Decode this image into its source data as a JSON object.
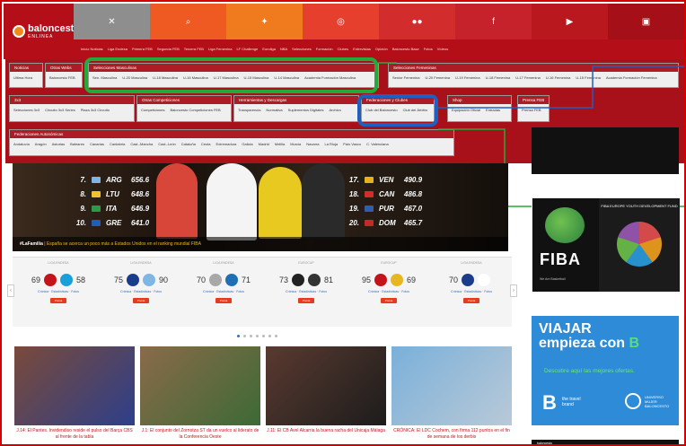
{
  "header": {
    "logo_text": "baloncesto",
    "logo_sub": "ENLINEA",
    "social_icons": [
      {
        "name": "x-icon",
        "glyph": "✕",
        "color": "#8e8e8e"
      },
      {
        "name": "search-icon",
        "glyph": "⌕",
        "color": "#ee5a22"
      },
      {
        "name": "twitter-icon",
        "glyph": "✦",
        "color": "#f07a1e"
      },
      {
        "name": "instagram-icon",
        "glyph": "◎",
        "color": "#e63f2d"
      },
      {
        "name": "flickr-icon",
        "glyph": "●●",
        "color": "#d22c2c"
      },
      {
        "name": "facebook-icon",
        "glyph": "f",
        "color": "#c6222b"
      },
      {
        "name": "youtube-icon",
        "glyph": "▶",
        "color": "#b9181f"
      },
      {
        "name": "app-icon",
        "glyph": "▣",
        "color": "#a51018"
      }
    ],
    "nav_links": [
      "Inicio Noticias",
      "Liga Endesa",
      "Primera FEB",
      "Segunda FEB",
      "Tercera FEB",
      "Liga Femenina",
      "LF Challenge",
      "Euroliga",
      "NBA",
      "Selecciones",
      "Formación",
      "Clubes",
      "Entrevistas",
      "Opinión",
      "Baloncesto Base",
      "Fotos",
      "Vídeos"
    ]
  },
  "menu": {
    "noticias": {
      "title": "Noticias",
      "items": [
        "Ultima Hora"
      ]
    },
    "otras": {
      "title": "Otras Webs",
      "items": [
        "Baloncesto FEB"
      ]
    },
    "masc": {
      "title": "Selecciones Masculinas",
      "items": [
        "Sen. Masculina",
        "U-20 Masculina",
        "U-18 Masculina",
        "U-16 Masculina",
        "U-17 Masculina",
        "U-15 Masculina",
        "U-14 Masculina",
        "Academia Formación Masculina"
      ]
    },
    "fem": {
      "title": "Selecciones Femeninas",
      "items": [
        "Senior Femenina",
        "U-20 Femenina",
        "U-19 Femenina",
        "U-18 Femenina",
        "U-17 Femenina",
        "U-16 Femenina",
        "U-15 Femenina",
        "Academia Formación Femenina"
      ]
    },
    "tres": {
      "title": "3x3",
      "items": [
        "Selecciones 3x3",
        "Circuito 3x3 Series",
        "Plaza 3x3 Circuito"
      ]
    },
    "comp": {
      "title": "Otras Competiciones",
      "items": [
        "Competiciones",
        "Baloncesto Competiciones FEB"
      ]
    },
    "herr": {
      "title": "Herramientas y Descargas",
      "items": [
        "Transparencia",
        "Normativa",
        "Suplementos Digitales",
        "Archivo"
      ]
    },
    "clubes": {
      "title": "Federaciones y Clubes",
      "items": [
        "Club del Baloncesto",
        "Club del Árbitro"
      ]
    },
    "shop": {
      "title": "Shop",
      "items": [
        "Equipación Oficial",
        "Entradas"
      ]
    },
    "prensa": {
      "title": "Prensa FEB",
      "items": [
        "Prensa FEB"
      ]
    },
    "auto": {
      "title": "Federaciones Autonómicas",
      "items": [
        "Andalucía",
        "Aragón",
        "Asturias",
        "Baleares",
        "Canarias",
        "Cantabria",
        "Cast.-Mancha",
        "Cast.-León",
        "Cataluña",
        "Ceuta",
        "Extremadura",
        "Galicia",
        "Madrid",
        "Melilla",
        "Murcia",
        "Navarra",
        "La Rioja",
        "País Vasco",
        "C. Valenciana"
      ]
    }
  },
  "hero": {
    "ranking_left": [
      {
        "pos": "7.",
        "code": "ARG",
        "pts": "656.6",
        "color": "#7fb5e6"
      },
      {
        "pos": "8.",
        "code": "LTU",
        "pts": "648.6",
        "color": "#f2c12e"
      },
      {
        "pos": "9.",
        "code": "ITA",
        "pts": "646.9",
        "color": "#2b9a4b"
      },
      {
        "pos": "10.",
        "code": "GRE",
        "pts": "641.0",
        "color": "#1d5fb5"
      }
    ],
    "ranking_right": [
      {
        "pos": "17.",
        "code": "VEN",
        "pts": "490.9",
        "color": "#e3b21c"
      },
      {
        "pos": "18.",
        "code": "CAN",
        "pts": "486.8",
        "color": "#d42c2c"
      },
      {
        "pos": "19.",
        "code": "PUR",
        "pts": "467.0",
        "color": "#2d5fb0"
      },
      {
        "pos": "20.",
        "code": "DOM",
        "pts": "465.7",
        "color": "#c32a2a"
      }
    ],
    "caption_tag": "#LaFamilia",
    "caption_text": "| España se acerca un poco más a Estados Unidos en el ranking mundial FIBA"
  },
  "scores": [
    {
      "comp": "LIGA ENDESA",
      "left": "69",
      "right": "58",
      "lc": "#c4141b",
      "rc": "#1aa0d8"
    },
    {
      "comp": "LIGA ENDESA",
      "left": "75",
      "right": "90",
      "lc": "#1b3c8a",
      "rc": "#7fb6e3"
    },
    {
      "comp": "LIGA ENDESA",
      "left": "70",
      "right": "71",
      "lc": "#a8a8a8",
      "rc": "#1f6fb5"
    },
    {
      "comp": "EUROCUP",
      "left": "73",
      "right": "81",
      "lc": "#222",
      "rc": "#333"
    },
    {
      "comp": "EUROCUP",
      "left": "95",
      "right": "69",
      "lc": "#c4141b",
      "rc": "#e6b722"
    },
    {
      "comp": "LIGA ENDESA",
      "left": "70",
      "right": "",
      "lc": "#1b3c8a",
      "rc": "#fff"
    }
  ],
  "score_links": "Crónica · Estadísticas · Fotos",
  "score_button": "Previa",
  "news": [
    {
      "title": "J.14: El Pantes. Invidendiso reside el pulso del Barça CBS al frente de la tabla",
      "c1": "#7a4a3a",
      "c2": "#2d3f8a"
    },
    {
      "title": "J.1: El conjunto del Zornotza ST da un vuelco al liderato de la Conferencia Oeste",
      "c1": "#8a6a4a",
      "c2": "#3d6a35"
    },
    {
      "title": "J.11: El CB Avel Alcarria la buena racha del Unicaja Málaga",
      "c1": "#5a3a30",
      "c2": "#1c1c1c"
    },
    {
      "title": "CRÓNICA: El LDC Cochem, con firma 112 puntos en el fin de semana de los derbis",
      "c1": "#7ab0d9",
      "c2": "#b9c9d8"
    }
  ],
  "sidebar": {
    "fiba_word": "FIBA",
    "fiba_sub": "We Are Basketball",
    "fiba_head": "FIBA EUROPE YOUTH DEVELOPMENT FUND",
    "viajar_1": "VIAJAR",
    "viajar_2": "empieza con",
    "viajar_b": "B",
    "viajar_note": "Descubre aquí las mejores ofertas.",
    "tb_1": "the travel",
    "tb_2": "brand",
    "um_1": "UNIVERSO",
    "um_2": "MUJER",
    "um_3": "BALONCESTO",
    "bottom": "baloncesto"
  }
}
